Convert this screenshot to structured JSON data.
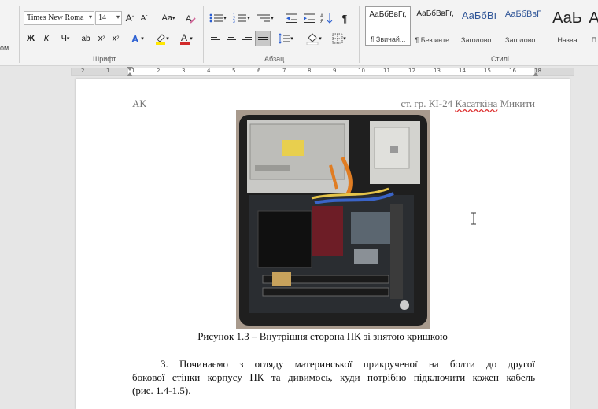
{
  "ribbon": {
    "left_clip": "ом",
    "font": {
      "name": "Times New Roma",
      "size": "14",
      "grow": "A",
      "shrink": "A",
      "case": "Aa",
      "bold": "Ж",
      "italic": "К",
      "underline": "Ч",
      "strike": "ab",
      "sub": "x",
      "sup": "x",
      "group_label": "Шрифт"
    },
    "paragraph": {
      "group_label": "Абзац",
      "pilcrow": "¶"
    },
    "styles": {
      "group_label": "Стилі",
      "items": [
        {
          "preview": "АаБбВвГг,",
          "name": "¶ Звичай..."
        },
        {
          "preview": "АаБбВвГг,",
          "name": "¶ Без инте..."
        },
        {
          "preview": "АаБбВı",
          "name": "Заголово..."
        },
        {
          "preview": "АаБбВвГ",
          "name": "Заголово..."
        },
        {
          "preview": "АаЬ",
          "name": "Назва"
        },
        {
          "preview": "А",
          "name": "П"
        }
      ]
    },
    "colors": {
      "highlight": "#ffe600",
      "font_color": "#d22b2b",
      "text_effects": "#2b5fd2"
    }
  },
  "ruler": {
    "numbers": [
      "2",
      "1",
      "1",
      "2",
      "3",
      "4",
      "5",
      "6",
      "7",
      "8",
      "9",
      "10",
      "11",
      "12",
      "13",
      "14",
      "15",
      "16",
      "18"
    ]
  },
  "document": {
    "header_left": "АК",
    "header_right_prefix": "ст. гр. КІ-24 ",
    "header_right_misspelled": "Касаткіна",
    "header_right_suffix": " Микити",
    "figure_caption": "Рисунок 1.3 – Внутрішня сторона ПК зі знятою кришкою",
    "paragraph_line1": "3. Починаємо з огляду материнської прикрученої на болти до другої",
    "paragraph_line2": "бокової стінки корпусу ПК та дивимось, куди потрібно підключити кожен кабель",
    "paragraph_line3": "(рис. 1.4-1.5)."
  }
}
